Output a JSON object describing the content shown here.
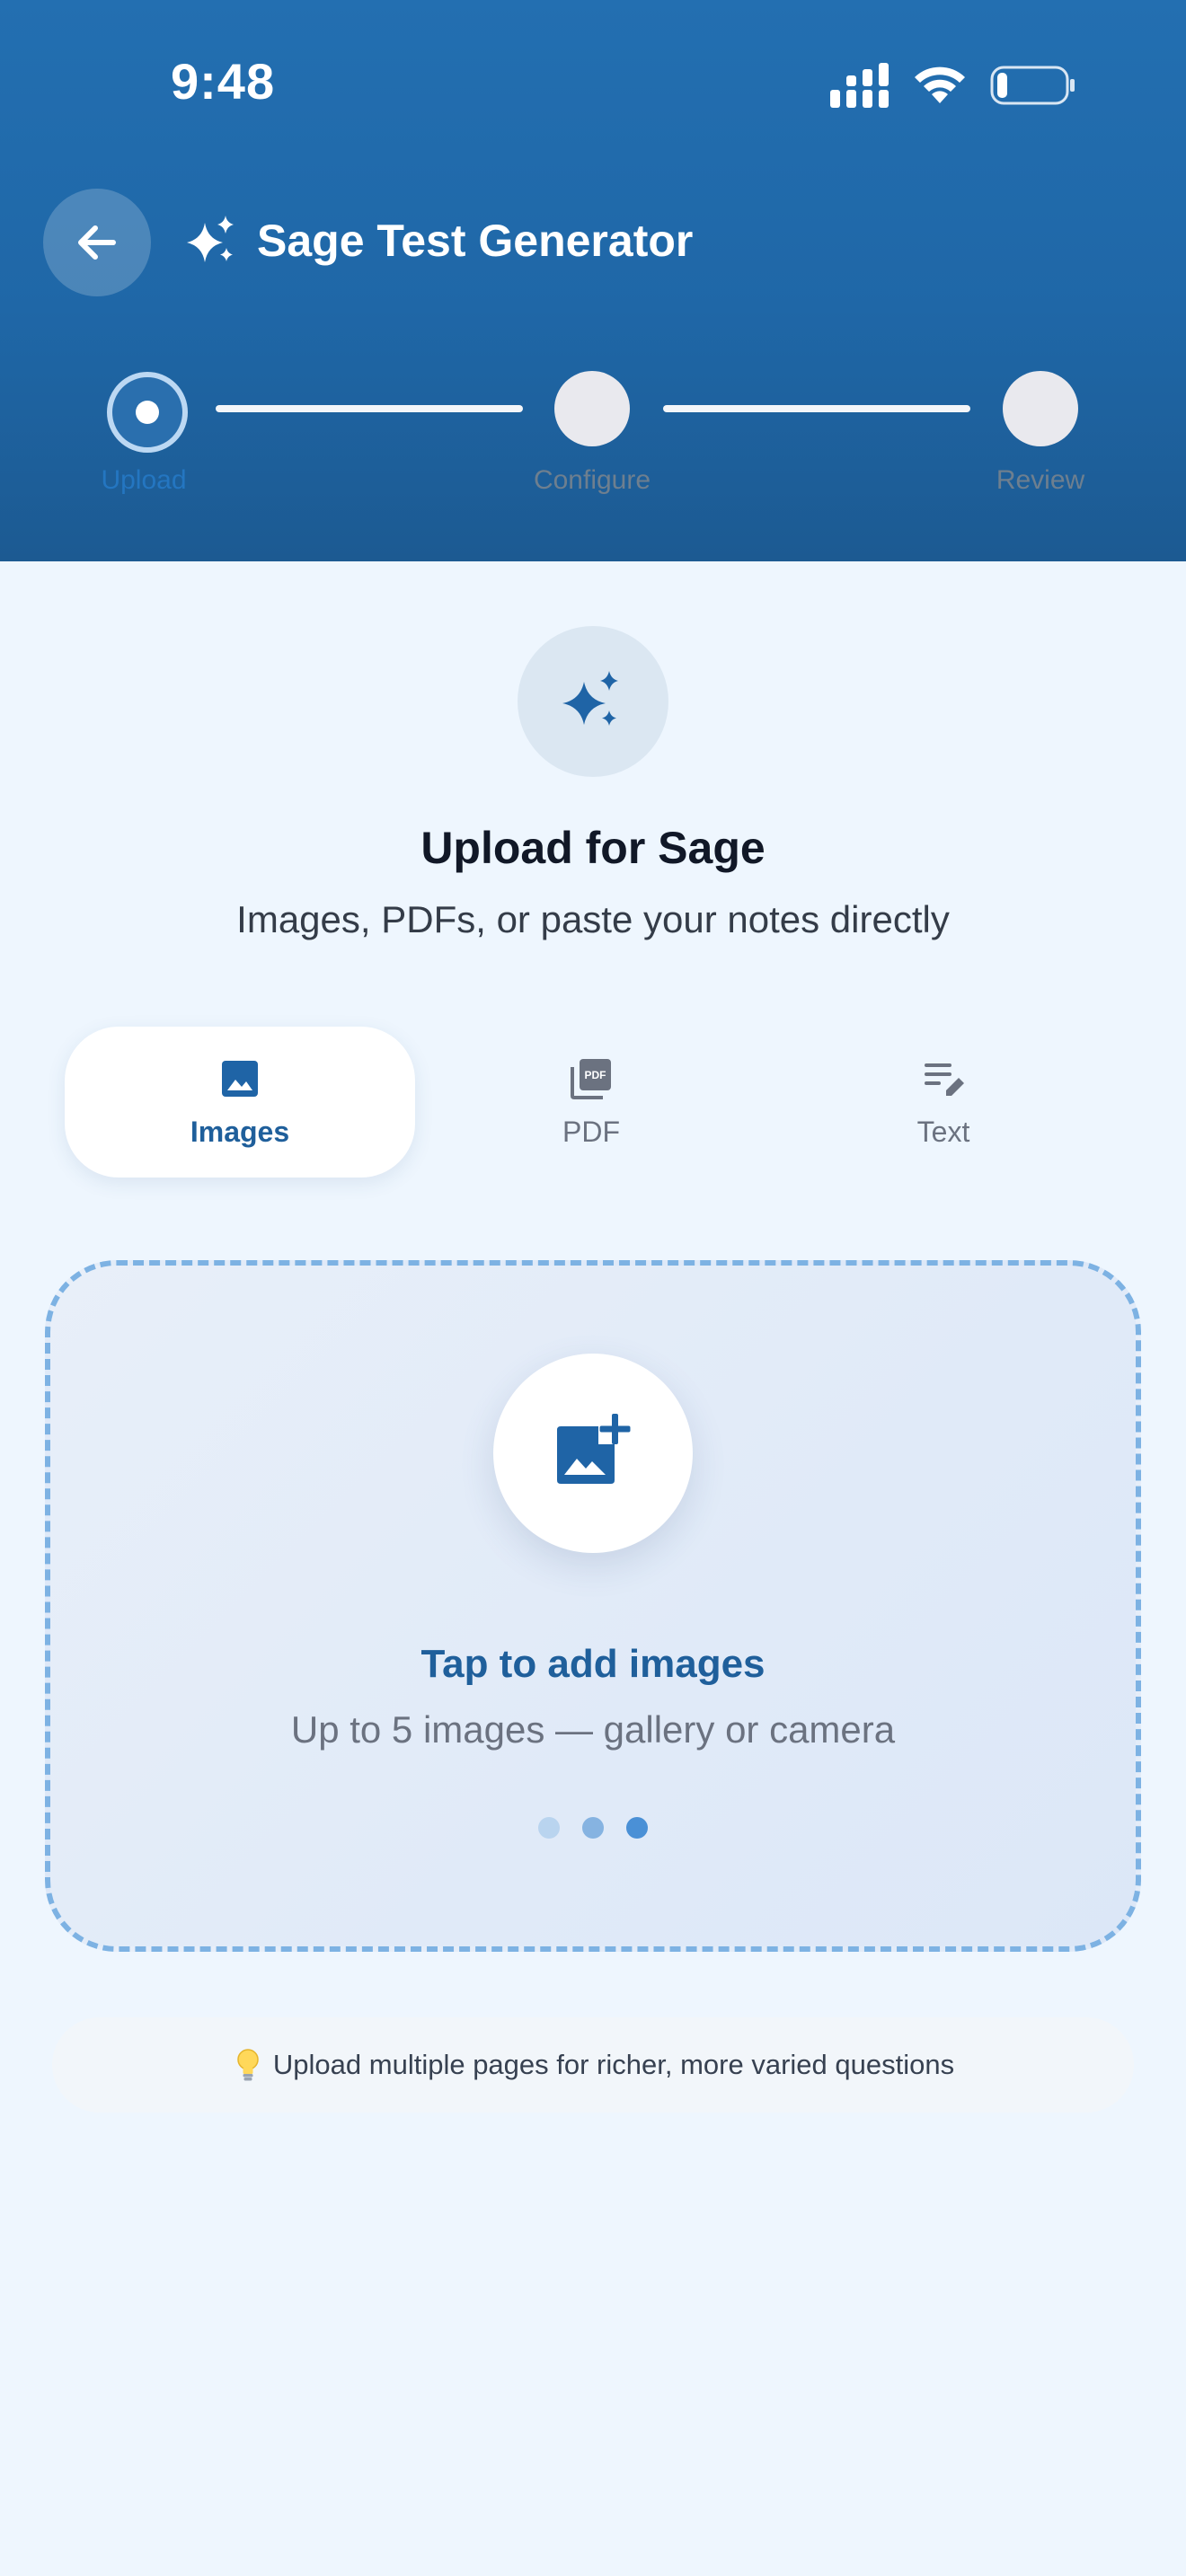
{
  "status_bar": {
    "time": "9:48",
    "icons": [
      "signal-icon",
      "wifi-icon",
      "battery-icon"
    ],
    "battery_level": 0.15
  },
  "header": {
    "back_icon": "arrow-left-icon",
    "title_icon": "sparkles-icon",
    "title": "Sage Test Generator"
  },
  "stepper": {
    "current_step": 1,
    "steps": [
      {
        "label": "Upload"
      },
      {
        "label": "Configure"
      },
      {
        "label": "Review"
      }
    ]
  },
  "hero": {
    "icon": "sparkles-icon",
    "title": "Upload for Sage",
    "subtitle": "Images, PDFs, or paste your notes directly"
  },
  "tabs": {
    "selected": "Images",
    "items": [
      {
        "label": "Images",
        "icon": "image-icon"
      },
      {
        "label": "PDF",
        "icon": "pdf-icon"
      },
      {
        "label": "Text",
        "icon": "text-edit-icon"
      }
    ]
  },
  "dropzone": {
    "icon": "add-photo-icon",
    "title": "Tap to add images",
    "subtitle": "Up to 5 images — gallery or camera",
    "indicator_count": 3,
    "active_indicator": 3
  },
  "tip": {
    "icon": "lightbulb-icon",
    "text": "Upload multiple pages for richer, more varied questions"
  },
  "colors": {
    "header_gradient_top": "#236fb1",
    "header_gradient_bottom": "#1c5a92",
    "background": "#eef6fe",
    "accent": "#2a6fae",
    "active_tab_label": "#1f5f9b",
    "dropzone_border": "#7db2e3"
  }
}
